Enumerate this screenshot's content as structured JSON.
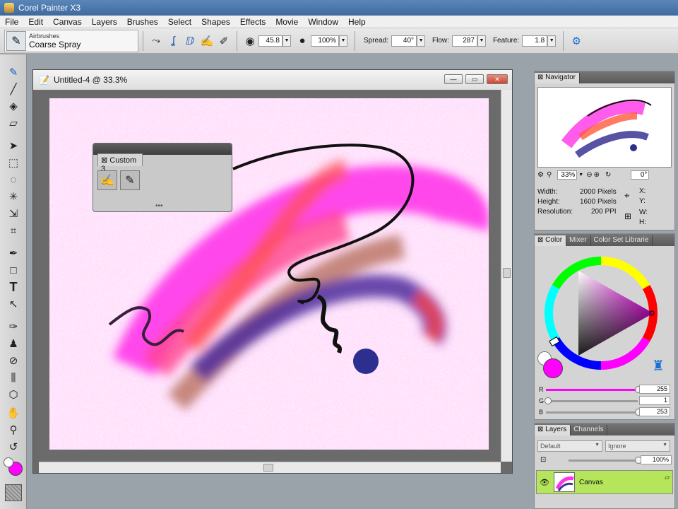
{
  "app": {
    "title": "Corel Painter X3"
  },
  "menu": [
    "File",
    "Edit",
    "Canvas",
    "Layers",
    "Brushes",
    "Select",
    "Shapes",
    "Effects",
    "Movie",
    "Window",
    "Help"
  ],
  "property_bar": {
    "brush_category": "Airbrushes",
    "brush_variant": "Coarse Spray",
    "size": "45.8",
    "opacity": "100%",
    "spread_label": "Spread:",
    "spread": "40°",
    "flow_label": "Flow:",
    "flow": "287",
    "feature_label": "Feature:",
    "feature": "1.8"
  },
  "document": {
    "title": "Untitled-4 @ 33.3%"
  },
  "custom_palette": {
    "title": "Custom 3"
  },
  "navigator": {
    "tab": "Navigator",
    "zoom": "33%",
    "rotation": "0°",
    "width_label": "Width:",
    "width_value": "2000 Pixels",
    "height_label": "Height:",
    "height_value": "1600 Pixels",
    "resolution_label": "Resolution:",
    "resolution_value": "200 PPI",
    "x_label": "X:",
    "y_label": "Y:",
    "w_label": "W:",
    "h_label": "H:"
  },
  "color_panel": {
    "tabs": [
      "Color",
      "Mixer",
      "Color Set Librarie"
    ],
    "r_label": "R",
    "r_value": "255",
    "g_label": "G",
    "g_value": "1",
    "b_label": "B",
    "b_value": "253",
    "main_color": "#ff01fd",
    "secondary_color": "#ffffff"
  },
  "layers_panel": {
    "tabs": [
      "Layers",
      "Channels"
    ],
    "composite_method": "Default",
    "depth": "Ignore",
    "opacity": "100%",
    "layer_name": "Canvas",
    "layer_bg": "#b5e55a"
  }
}
